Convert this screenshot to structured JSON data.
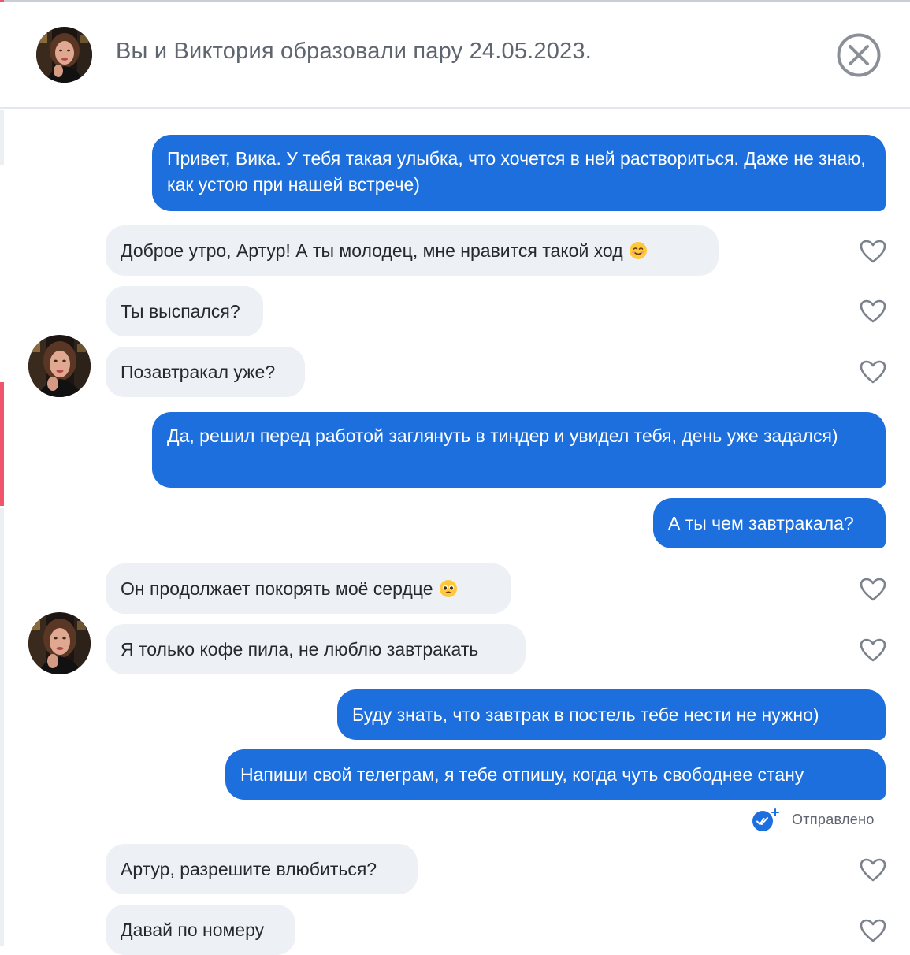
{
  "header": {
    "title": "Вы и Виктория образовали пару 24.05.2023."
  },
  "messages": [
    {
      "id": "m1",
      "direction": "out",
      "text": "Привет, Вика. У тебя такая улыбка, что хочется в ней раствориться. Даже не знаю, как устою при нашей встрече)"
    },
    {
      "id": "m2",
      "direction": "in",
      "text": "Доброе утро, Артур! А ты молодец, мне нравится такой ход",
      "emoji": "smiling-face-icon"
    },
    {
      "id": "m3",
      "direction": "in",
      "text": "Ты выспался?"
    },
    {
      "id": "m4",
      "direction": "in",
      "text": "Позавтракал уже?"
    },
    {
      "id": "m5",
      "direction": "out",
      "text": "Да, решил перед работой заглянуть в тиндер и увидел тебя, день уже задался)"
    },
    {
      "id": "m6",
      "direction": "out",
      "text": "А ты чем завтракала?"
    },
    {
      "id": "m7",
      "direction": "in",
      "text": "Он продолжает покорять моё сердце",
      "emoji": "pleading-face-icon"
    },
    {
      "id": "m8",
      "direction": "in",
      "text": "Я только кофе пила, не люблю завтракать"
    },
    {
      "id": "m9",
      "direction": "out",
      "text": "Буду знать, что завтрак в постель тебе нести не нужно)"
    },
    {
      "id": "m10",
      "direction": "out",
      "text": "Напиши свой телеграм, я тебе отпишу, когда чуть свободнее стану"
    },
    {
      "id": "m11",
      "direction": "in",
      "text": "Артур, разрешите влюбиться?"
    },
    {
      "id": "m12",
      "direction": "in",
      "text": "Давай по номеру"
    }
  ],
  "status": {
    "sent_label": "Отправлено",
    "icon": "double-check-icon"
  },
  "colors": {
    "outgoing_bubble": "#1c6fdc",
    "incoming_bubble": "#edf0f4",
    "accent": "#f0556c"
  }
}
